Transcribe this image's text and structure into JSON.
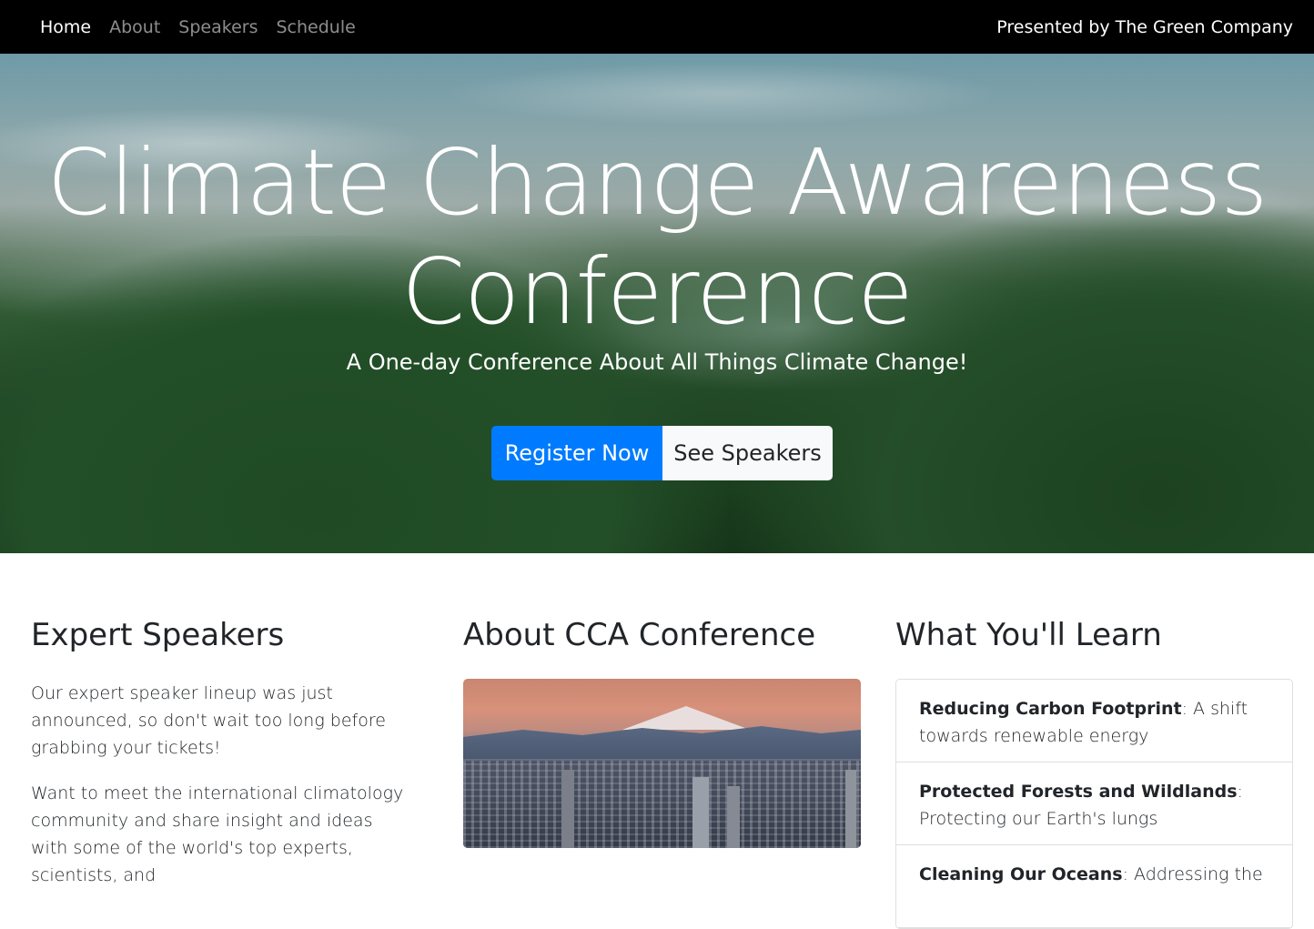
{
  "nav": {
    "links": [
      {
        "label": "Home",
        "active": true
      },
      {
        "label": "About",
        "active": false
      },
      {
        "label": "Speakers",
        "active": false
      },
      {
        "label": "Schedule",
        "active": false
      }
    ],
    "right_text": "Presented by The Green Company"
  },
  "hero": {
    "title_line1": "Climate Change Awareness",
    "title_line2": "Conference",
    "subtitle": "A One-day Conference About All Things Climate Change!",
    "primary_button": "Register Now",
    "secondary_button": "See Speakers"
  },
  "speakers": {
    "heading": "Expert Speakers",
    "p1": "Our expert speaker lineup was just announced, so don't wait too long before grabbing your tickets!",
    "p2": "Want to meet the international climatology community and share insight and ideas with some of the world's top experts, scientists, and"
  },
  "about": {
    "heading": "About CCA Conference",
    "image_name": "city-mountain-photo"
  },
  "learn": {
    "heading": "What You'll Learn",
    "items": [
      {
        "bold": "Reducing Carbon Footprint",
        "sep": ":",
        "text": " A shift towards renewable energy"
      },
      {
        "bold": "Protected Forests and Wildlands",
        "sep": ":",
        "text": " Protecting our Earth's lungs"
      },
      {
        "bold": "Cleaning Our Oceans",
        "sep": ":",
        "text": " Addressing the"
      }
    ]
  },
  "colors": {
    "navbar_bg": "#000000",
    "primary": "#007bff",
    "light": "#f8f9fa"
  }
}
